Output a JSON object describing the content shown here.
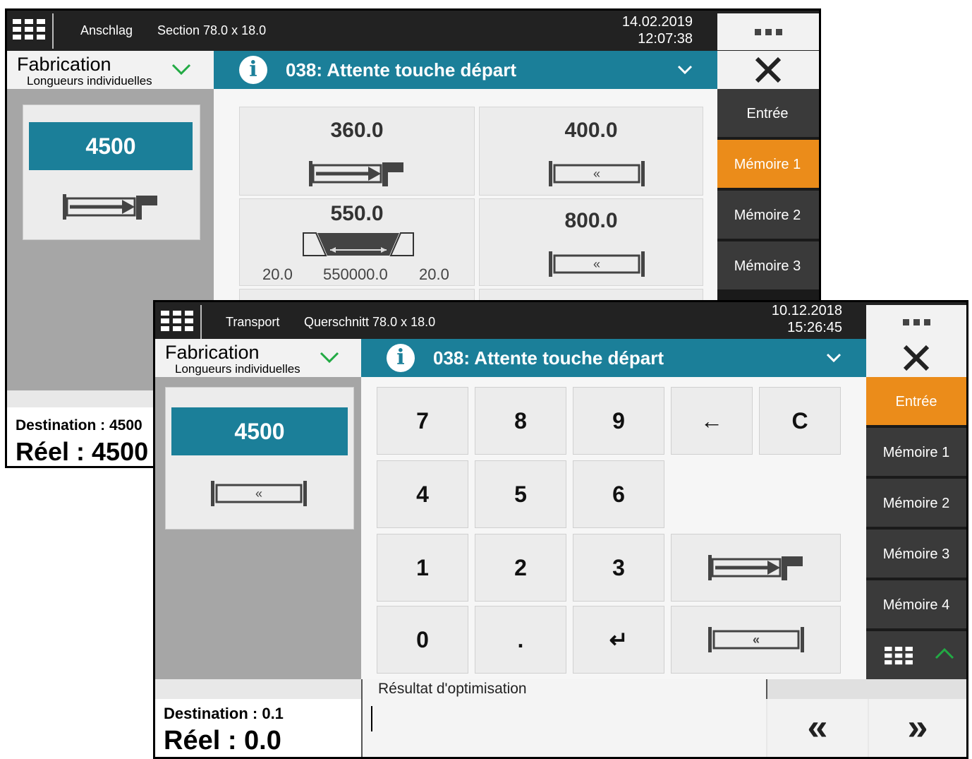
{
  "back": {
    "topbar": {
      "label1": "Anschlag",
      "label2": "Section 78.0 x 18.0",
      "date": "14.02.2019",
      "time": "12:07:38"
    },
    "mode": {
      "title": "Fabrication",
      "subtitle": "Longueurs individuelles"
    },
    "message": "038: Attente touche départ",
    "side": [
      "Entrée",
      "Mémoire 1",
      "Mémoire 2",
      "Mémoire 3"
    ],
    "active_side": "Mémoire 1",
    "value": "4500",
    "tiles": [
      {
        "value": "360.0",
        "icon": "stop-arrow-icon"
      },
      {
        "value": "400.0",
        "icon": "rewind-bar-icon"
      },
      {
        "value": "550.0",
        "icon": "trapezoid-cut-icon",
        "left": "20.0",
        "mid": "550000.0",
        "right": "20.0"
      },
      {
        "value": "800.0",
        "icon": "rewind-bar-icon"
      }
    ],
    "destination": "Destination : 4500",
    "reel": "Réel : 4500"
  },
  "front": {
    "topbar": {
      "label1": "Transport",
      "label2": "Querschnitt 78.0 x 18.0",
      "date": "10.12.2018",
      "time": "15:26:45"
    },
    "mode": {
      "title": "Fabrication",
      "subtitle": "Longueurs individuelles"
    },
    "message": "038: Attente touche départ",
    "side": [
      "Entrée",
      "Mémoire 1",
      "Mémoire 2",
      "Mémoire 3",
      "Mémoire 4"
    ],
    "active_side": "Entrée",
    "value": "4500",
    "keys": [
      "7",
      "8",
      "9",
      "←",
      "C",
      "4",
      "5",
      "6",
      "1",
      "2",
      "3",
      "0",
      ".",
      "↵"
    ],
    "result_label": "Résultat d'optimisation",
    "destination": "Destination : 0.1",
    "reel": "Réel : 0.0",
    "nav": {
      "prev": "«",
      "next": "»"
    }
  },
  "colors": {
    "accent_blue": "#1b7f99",
    "accent_orange": "#eb8c1a",
    "dark": "#222222",
    "check_green": "#22aa44"
  }
}
